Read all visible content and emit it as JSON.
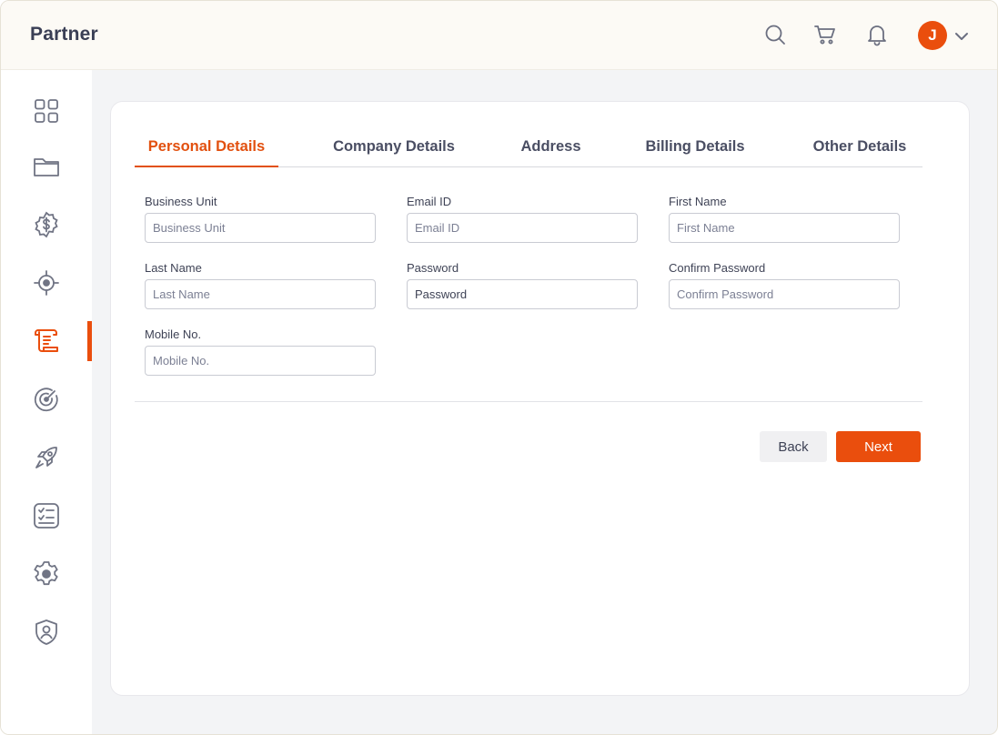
{
  "app": {
    "title": "Partner"
  },
  "header": {
    "icons": [
      "search-icon",
      "cart-icon",
      "bell-icon"
    ],
    "avatar_initial": "J"
  },
  "sidebar": {
    "items": [
      {
        "icon": "dashboard-grid-icon",
        "active": false
      },
      {
        "icon": "folder-icon",
        "active": false
      },
      {
        "icon": "dollar-badge-icon",
        "active": false
      },
      {
        "icon": "target-icon",
        "active": false
      },
      {
        "icon": "scroll-document-icon",
        "active": true
      },
      {
        "icon": "radar-icon",
        "active": false
      },
      {
        "icon": "rocket-icon",
        "active": false
      },
      {
        "icon": "checklist-icon",
        "active": false
      },
      {
        "icon": "gear-icon",
        "active": false
      },
      {
        "icon": "user-shield-icon",
        "active": false
      }
    ]
  },
  "tabs": [
    {
      "label": "Personal Details",
      "active": true
    },
    {
      "label": "Company Details",
      "active": false
    },
    {
      "label": "Address",
      "active": false
    },
    {
      "label": "Billing Details",
      "active": false
    },
    {
      "label": "Other Details",
      "active": false
    }
  ],
  "form": {
    "business_unit": {
      "label": "Business Unit",
      "placeholder": "Business Unit",
      "value": ""
    },
    "email_id": {
      "label": "Email ID",
      "placeholder": "Email ID",
      "value": ""
    },
    "first_name": {
      "label": "First Name",
      "placeholder": "First Name",
      "value": ""
    },
    "last_name": {
      "label": "Last Name",
      "placeholder": "Last Name",
      "value": ""
    },
    "password": {
      "label": "Password",
      "placeholder": "Password",
      "value": "Password"
    },
    "confirm_password": {
      "label": "Confirm Password",
      "placeholder": "Confirm Password",
      "value": ""
    },
    "mobile_no": {
      "label": "Mobile No.",
      "placeholder": "Mobile No.",
      "value": ""
    }
  },
  "actions": {
    "back_label": "Back",
    "next_label": "Next"
  },
  "colors": {
    "accent": "#ea4e0d",
    "header_bg": "#fcfaf5",
    "page_bg": "#f3f4f6"
  }
}
